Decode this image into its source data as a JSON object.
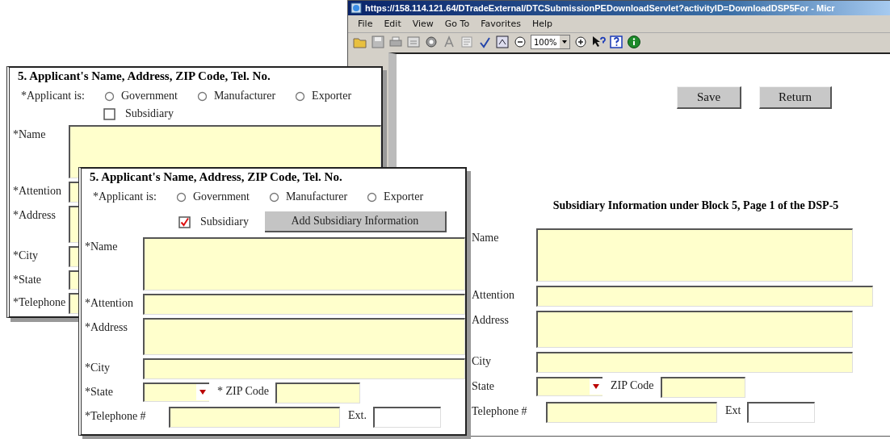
{
  "browser_window": {
    "title": "https://158.114.121.64/DTradeExternal/DTCSubmissionPEDownloadServlet?activityID=DownloadDSP5For - Micr",
    "menu": [
      "File",
      "Edit",
      "View",
      "Go To",
      "Favorites",
      "Help"
    ],
    "zoom": "100%",
    "buttons": [
      "Save",
      "Return"
    ],
    "form": {
      "heading": "Subsidiary Information under Block 5, Page 1 of the DSP-5",
      "rows": [
        {
          "kind": "large",
          "label": "Name"
        },
        {
          "kind": "wide",
          "label": "Attention"
        },
        {
          "kind": "medium",
          "label": "Address"
        },
        {
          "kind": "text",
          "label": "City"
        },
        {
          "kind": "state_zip",
          "label": "State",
          "zip_label": "ZIP Code"
        },
        {
          "kind": "phone",
          "label": "Telephone #",
          "ext_label": "Ext"
        }
      ]
    }
  },
  "back_form": {
    "title": "5.  Applicant's Name, Address, ZIP Code, Tel. No.",
    "applicant": {
      "label": "*Applicant is:",
      "options": [
        {
          "label": "Government",
          "selected": false
        },
        {
          "label": "Manufacturer",
          "selected": false
        },
        {
          "label": "Exporter",
          "selected": false
        }
      ]
    },
    "subsidiary": {
      "label": "Subsidiary",
      "checked": false
    },
    "rows": [
      {
        "kind": "large",
        "label": "*Name"
      },
      {
        "kind": "text",
        "label": "*Attention"
      },
      {
        "kind": "medium",
        "label": "*Address"
      },
      {
        "kind": "text",
        "label": "*City"
      },
      {
        "kind": "select",
        "label": "*State"
      },
      {
        "kind": "text",
        "label": "*Telephone"
      }
    ]
  },
  "front_form": {
    "title": "5.  Applicant's Name, Address, ZIP Code, Tel. No.",
    "applicant": {
      "label": "*Applicant is:",
      "options": [
        {
          "label": "Government",
          "selected": false
        },
        {
          "label": "Manufacturer",
          "selected": false
        },
        {
          "label": "Exporter",
          "selected": false
        }
      ]
    },
    "subsidiary": {
      "label": "Subsidiary",
      "checked": true
    },
    "add_button": "Add Subsidiary Information",
    "rows": [
      {
        "kind": "large",
        "label": "*Name"
      },
      {
        "kind": "text",
        "label": "*Attention"
      },
      {
        "kind": "medium",
        "label": "*Address"
      },
      {
        "kind": "text",
        "label": "*City"
      },
      {
        "kind": "state_zip",
        "label": "*State",
        "zip_label": "* ZIP Code"
      },
      {
        "kind": "phone",
        "label": "*Telephone #",
        "ext_label": "Ext."
      }
    ]
  }
}
